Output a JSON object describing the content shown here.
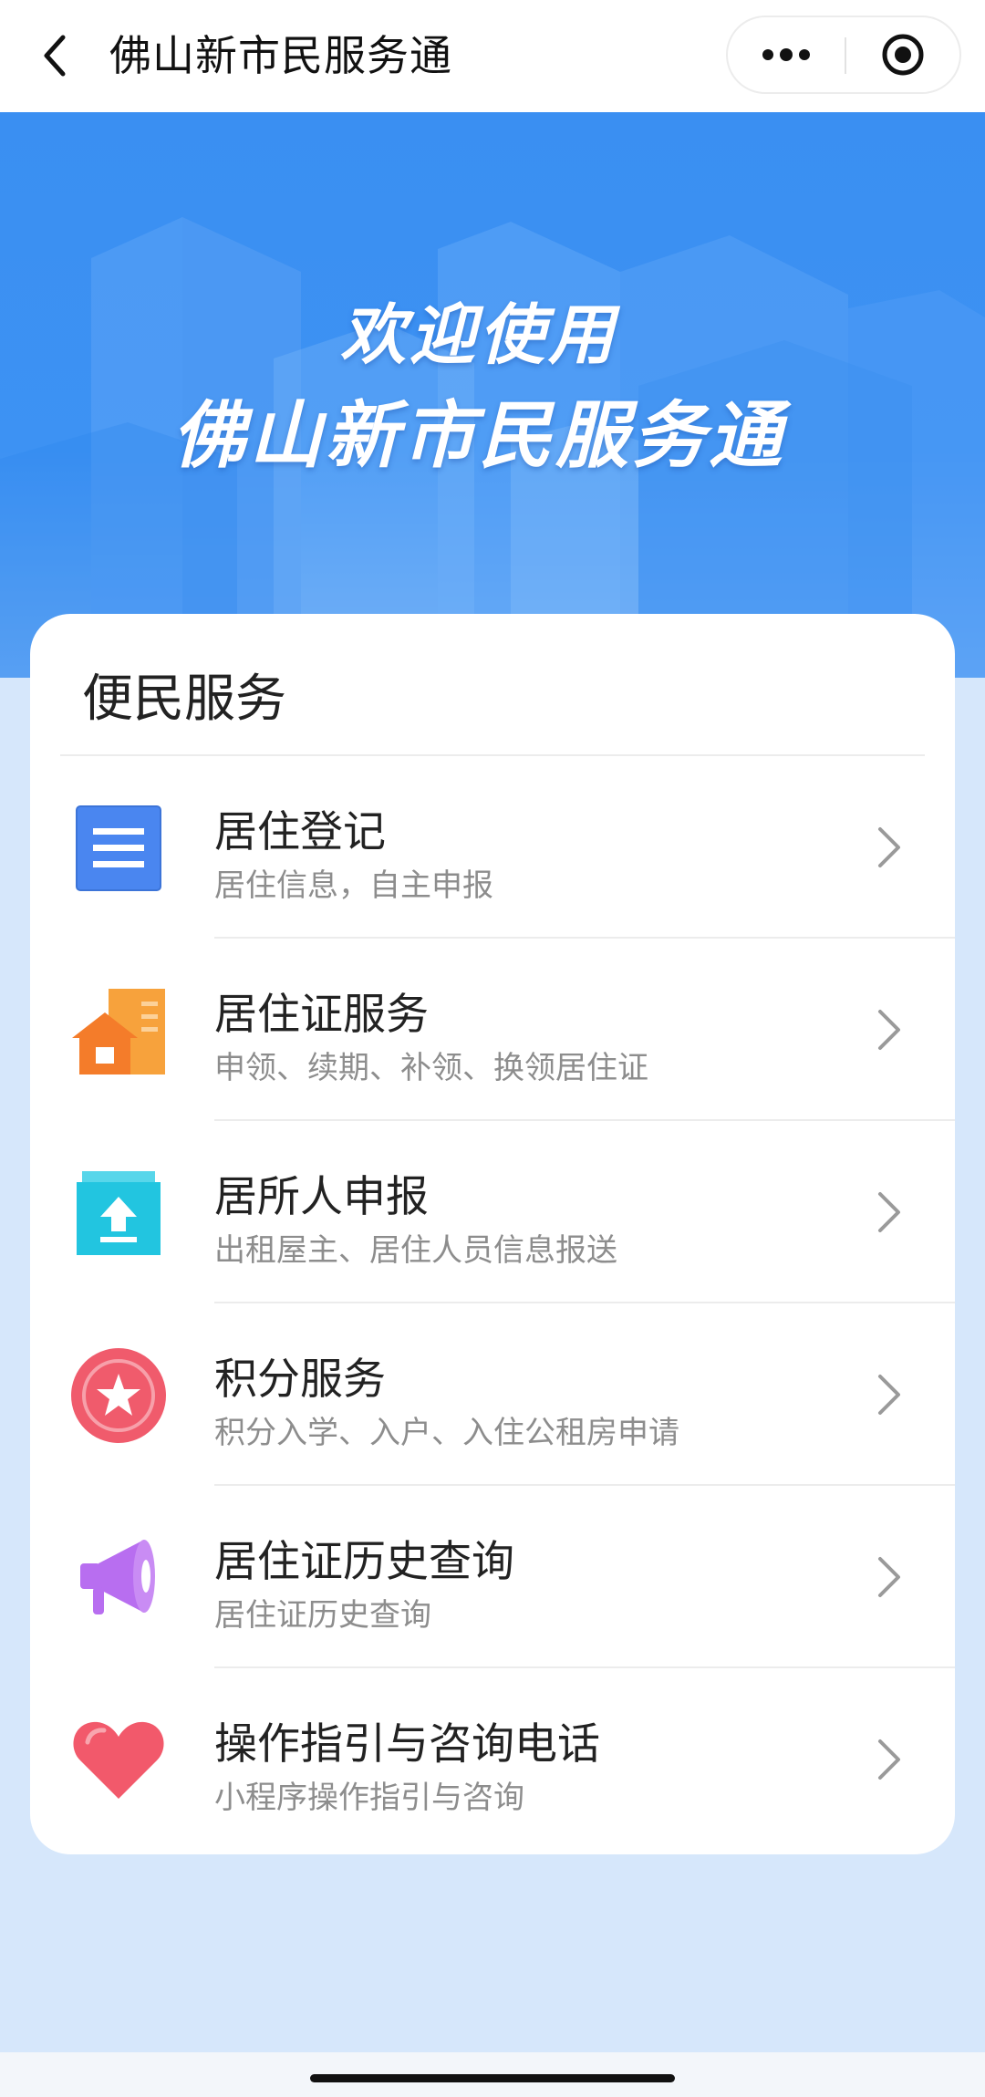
{
  "header": {
    "title": "佛山新市民服务通",
    "back_icon": "chevron-left-icon",
    "more_icon": "more-dots-icon",
    "close_icon": "target-circle-icon"
  },
  "banner": {
    "line1": "欢迎使用",
    "line2": "佛山新市民服务通",
    "color_top": "#3a8ff2"
  },
  "services": {
    "title": "便民服务",
    "items": [
      {
        "name": "居住登记",
        "desc": "居住信息，自主申报",
        "icon": "document-list-icon",
        "color": "#4a86f0"
      },
      {
        "name": "居住证服务",
        "desc": "申领、续期、补领、换领居住证",
        "icon": "house-building-icon",
        "color": "#f7a23c"
      },
      {
        "name": "居所人申报",
        "desc": "出租屋主、居住人员信息报送",
        "icon": "upload-box-icon",
        "color": "#22c5e0"
      },
      {
        "name": "积分服务",
        "desc": "积分入学、入户、入住公租房申请",
        "icon": "star-badge-icon",
        "color": "#f05b6c"
      },
      {
        "name": "居住证历史查询",
        "desc": "居住证历史查询",
        "icon": "megaphone-icon",
        "color": "#b86ef0"
      },
      {
        "name": "操作指引与咨询电话",
        "desc": "小程序操作指引与咨询",
        "icon": "heart-icon",
        "color": "#f2596b"
      }
    ]
  }
}
